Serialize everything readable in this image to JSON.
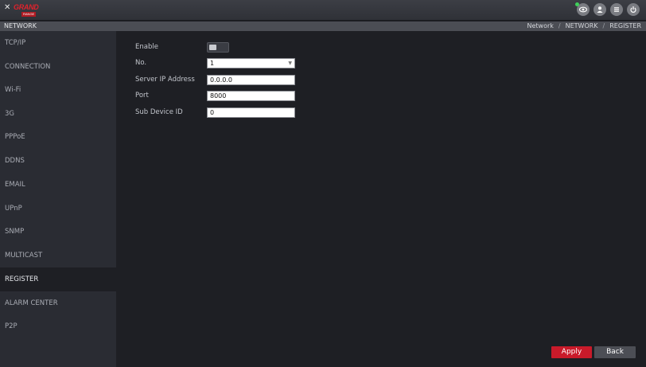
{
  "header": {
    "logo_mark": "✕",
    "logo_brand": "GRAND",
    "logo_sub": "RANGE",
    "icons": [
      "eye-icon",
      "user-icon",
      "menu-icon",
      "power-icon"
    ],
    "status_color": "#3fd05a"
  },
  "nav": {
    "title": "NETWORK",
    "breadcrumb": [
      "Network",
      "/",
      "NETWORK",
      "/",
      "REGISTER"
    ]
  },
  "sidebar": {
    "items": [
      {
        "label": "TCP/IP"
      },
      {
        "label": "CONNECTION"
      },
      {
        "label": "Wi-Fi"
      },
      {
        "label": "3G"
      },
      {
        "label": "PPPoE"
      },
      {
        "label": "DDNS"
      },
      {
        "label": "EMAIL"
      },
      {
        "label": "UPnP"
      },
      {
        "label": "SNMP"
      },
      {
        "label": "MULTICAST"
      },
      {
        "label": "REGISTER",
        "active": true
      },
      {
        "label": "ALARM CENTER"
      },
      {
        "label": "P2P"
      }
    ]
  },
  "form": {
    "enable_label": "Enable",
    "enable_value": false,
    "no_label": "No.",
    "no_value": "1",
    "server_ip_label": "Server IP Address",
    "server_ip_value": "0.0.0.0",
    "port_label": "Port",
    "port_value": "8000",
    "sub_device_label": "Sub Device ID",
    "sub_device_value": "0"
  },
  "buttons": {
    "apply": "Apply",
    "back": "Back"
  },
  "colors": {
    "accent": "#c91a2a",
    "background": "#1e1f24",
    "sidebar": "#2a2c33"
  }
}
